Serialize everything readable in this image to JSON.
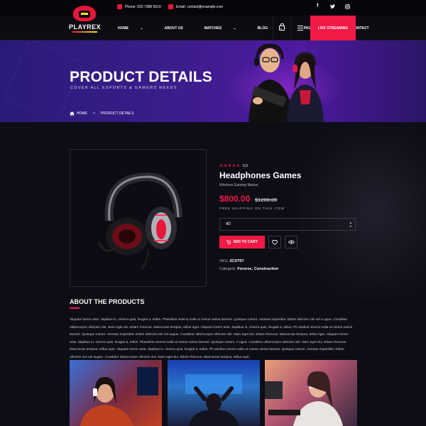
{
  "topbar": {
    "phone": "Phone: 020 7388 5619",
    "email": "Email: contact@example.com",
    "social": [
      "f",
      "t",
      "ig"
    ]
  },
  "header": {
    "logo_text": "PLAYREX",
    "nav": [
      "HOME",
      "ABOUT US",
      "MATCHES",
      "BLOG",
      "PAGES",
      "CONTACT"
    ],
    "nav_dropdown": [
      true,
      false,
      true,
      true,
      true,
      false
    ],
    "live_button": "LIVE STREAMING",
    "cart_icon": "bag-icon",
    "menu_icon": "hamburger-icon"
  },
  "hero": {
    "title": "PRODUCT DETAILS",
    "subtitle": "COVER ALL ESPORTS & GAMERS NEEDS",
    "breadcrumb_home": "HOME",
    "breadcrumb_sep": ">",
    "breadcrumb_current": "PRODUCT DETAILS"
  },
  "product": {
    "stars": "★★★★★",
    "rating": "5.0",
    "title": "Headphones Games",
    "subtitle": "Wireless Gaming Mouse",
    "price": "$800.00",
    "old_price": "$1200.00",
    "shipping": "FREE SHIPPING ON THIS ITEM",
    "quantity": "40",
    "add_to_cart": "ADD TO CART",
    "sku_label": "SKU:",
    "sku": "2CST07",
    "category_label": "Category:",
    "categories": "Forsroc, Construction",
    "wishlist_icon": "heart-icon",
    "view_icon": "eye-icon"
  },
  "about": {
    "title": "ABOUT THE PRODUCTS",
    "text": "Aliquam lorem ante, dapibus in, viverra quis, feugiat a, tellus. Phasellus viverra nulla ut metus varius laoreet. Quisque rutrum. Aenean imperdiet. Etiam ultricies nisi vel a ugue. Curabitur ullamcorper ultricies nisi. Nam eget dui. Etiam rhoncus. Maecenas tempus, tellus eget. Aliquam lorem ante, dapibus in, viverra quis, feugiat a, tellus. Ph asellus viverra nulla ut metus varius laoreet. Quisque rutrum. Aenean imperdiet. Etiam ultricies nisi vel augue. Curabitur ullamcorper ultricies nisi. Nam eget dui. Etiam rhoncus. Maecenas tempus, tellus eget. Aliquam lorem ante, dapibus in, viverra quis, feugiat a, tellus. Phasellus viverra nulla ut metus varius laoreet. Quisque rutrum. A ugue. Curabitur ullamcorper ultricies nisi. Nam eget dui. Etiam rhoncus. Maecenas tempus, tellus eget. Aliquam lorem ante, dapibus in, viverra quis, feugiat a, tellus. Ph asellus viverra nulla ut metus varius laoreet. Quisque rutrum. Aenean imperdiet. Etiam ultricies nisi vel augue. Curabitur ullamcorper ultricies nisi. Nam eget dui. Etiam rhoncus. Maecenas tempus, tellus eget."
  },
  "colors": {
    "accent": "#f01a47",
    "hero_bg": "#3a1d8a",
    "page_bg": "#0d0d16"
  }
}
